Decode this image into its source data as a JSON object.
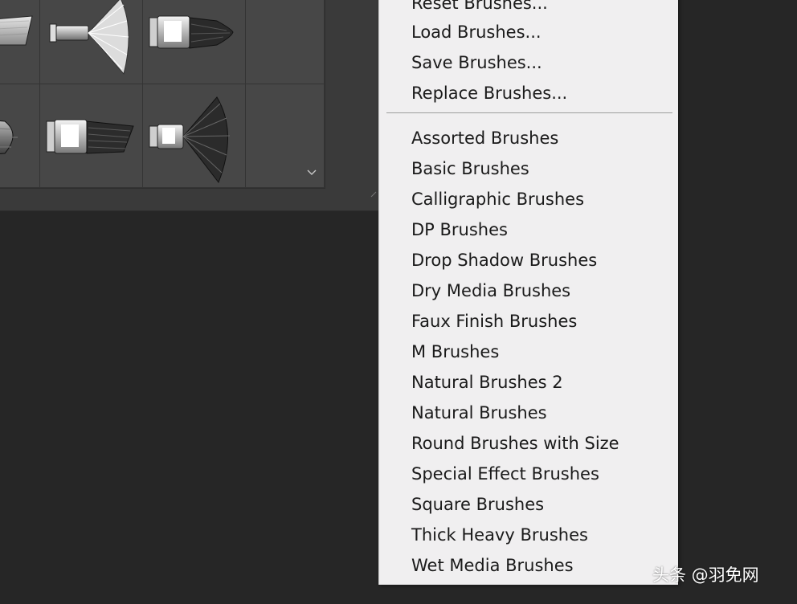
{
  "menu": {
    "top_items": [
      {
        "label": "Reset Brushes..."
      },
      {
        "label": "Load Brushes..."
      },
      {
        "label": "Save Brushes..."
      },
      {
        "label": "Replace Brushes..."
      }
    ],
    "library_items": [
      {
        "label": "Assorted Brushes"
      },
      {
        "label": "Basic Brushes"
      },
      {
        "label": "Calligraphic Brushes"
      },
      {
        "label": "DP Brushes"
      },
      {
        "label": "Drop Shadow Brushes"
      },
      {
        "label": "Dry Media Brushes"
      },
      {
        "label": "Faux Finish Brushes"
      },
      {
        "label": "M Brushes"
      },
      {
        "label": "Natural Brushes 2"
      },
      {
        "label": "Natural Brushes"
      },
      {
        "label": "Round Brushes with Size"
      },
      {
        "label": "Special Effect Brushes"
      },
      {
        "label": "Square Brushes"
      },
      {
        "label": "Thick Heavy Brushes"
      },
      {
        "label": "Wet Media Brushes"
      }
    ]
  },
  "brush_panel": {
    "icons": [
      "flat-brush-icon",
      "fan-brush-icon",
      "filbert-brush-icon",
      "round-brush-icon",
      "flat-angle-brush-icon",
      "fan-brush-dark-icon"
    ],
    "colors": {
      "panel_bg": "#3a3a3a",
      "cell_bg": "#474747",
      "menu_bg": "#f0eff0"
    }
  },
  "watermark": {
    "text": "头条 @羽免网"
  }
}
